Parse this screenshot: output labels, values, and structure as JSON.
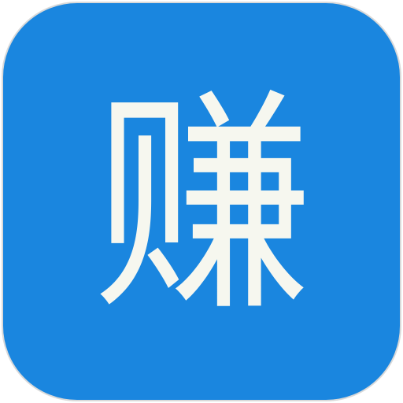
{
  "icon": {
    "glyph": "赚",
    "background_color": "#1a86df",
    "glyph_color": "#f6f7ef"
  }
}
